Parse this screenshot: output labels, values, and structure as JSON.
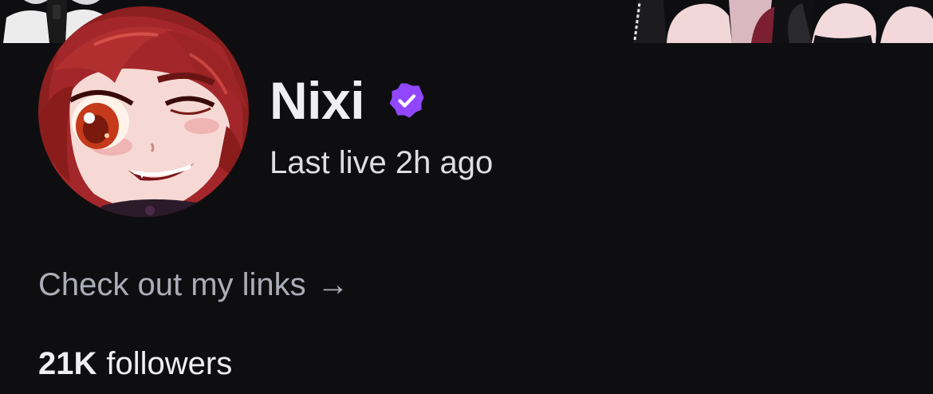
{
  "channel": {
    "name": "Nixi",
    "verified": true,
    "last_live": "Last live 2h ago",
    "links_text": "Check out my links",
    "links_arrow": "→",
    "followers_count": "21K",
    "followers_label": "followers"
  },
  "colors": {
    "background": "#0e0e10",
    "text_primary": "#efeff1",
    "text_secondary": "#adadb8",
    "verified_badge": "#9147ff"
  },
  "icons": {
    "verified": "verified-badge-icon",
    "avatar": "channel-avatar",
    "banner": "channel-banner"
  }
}
